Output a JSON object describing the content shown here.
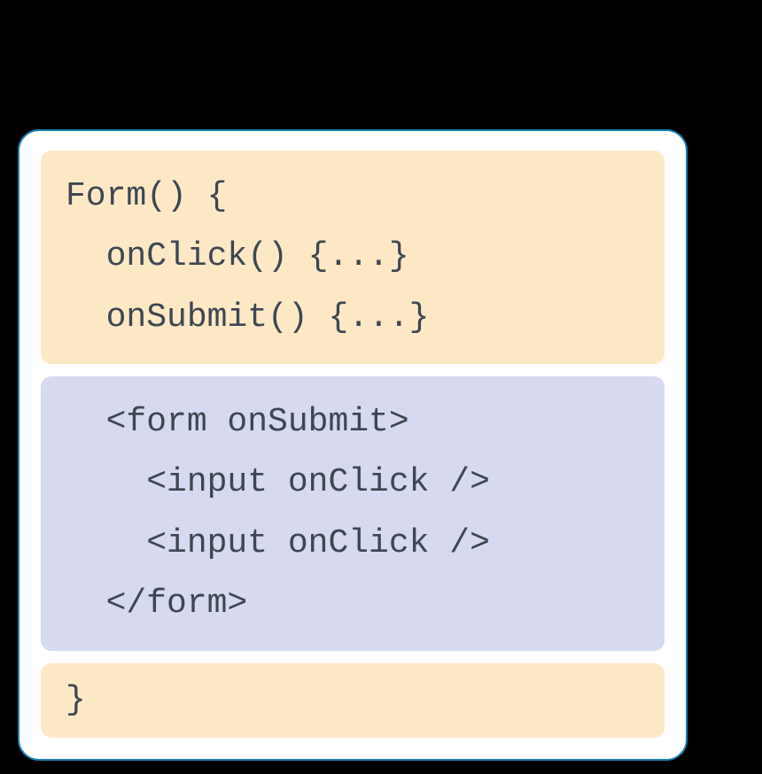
{
  "code": {
    "topBlock": "Form() {\n  onClick() {...}\n  onSubmit() {...}",
    "middleBlock": "  <form onSubmit>\n    <input onClick />\n    <input onClick />\n  </form>",
    "bottomBlock": "}"
  },
  "colors": {
    "cardBorder": "#1a7fb0",
    "orangeBlock": "#fde8c6",
    "purpleBlock": "#d6d9f0",
    "textColor": "#3d4651"
  }
}
